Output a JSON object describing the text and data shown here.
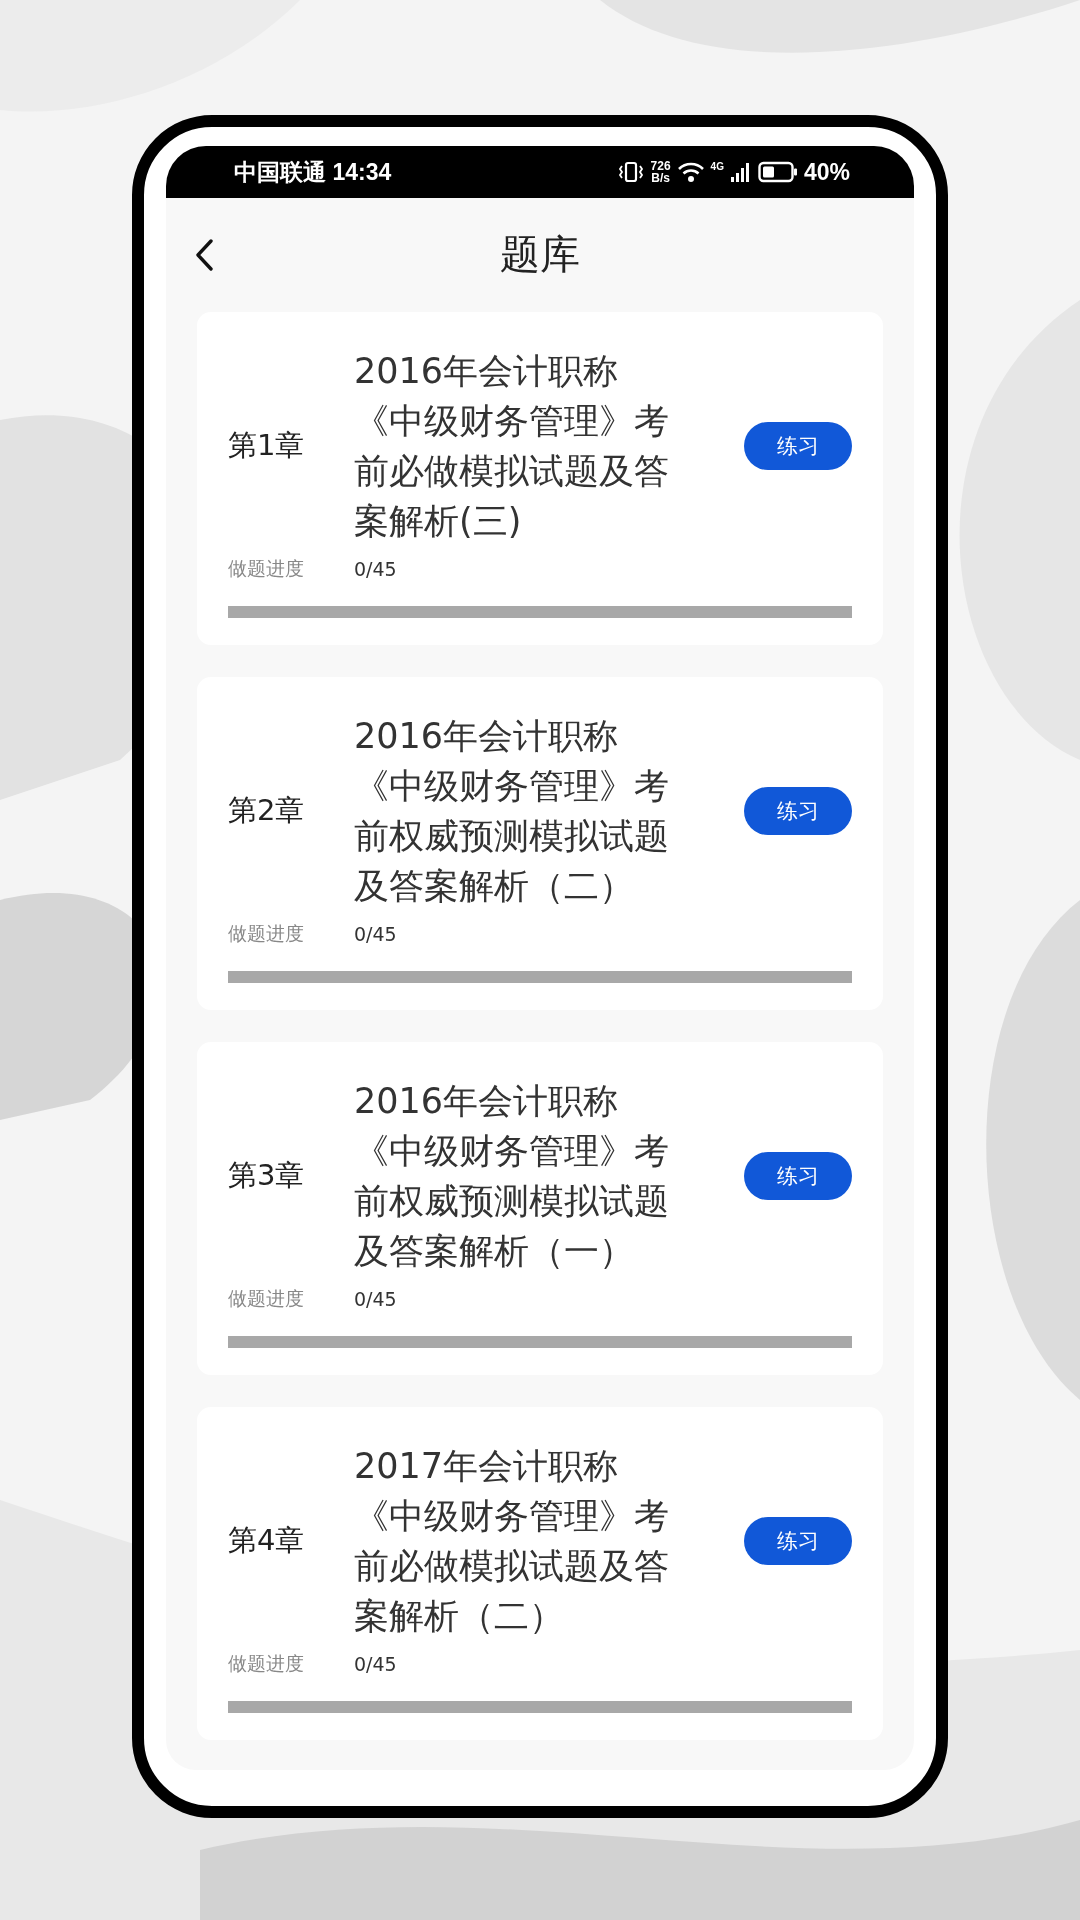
{
  "status_bar": {
    "carrier_time": "中国联通 14:34",
    "net_speed_value": "726",
    "net_speed_unit": "B/s",
    "network_type": "4G",
    "battery_level_text": "40%"
  },
  "header": {
    "title": "题库"
  },
  "chapters": [
    {
      "chapter": "第1章",
      "title": "2016年会计职称《中级财务管理》考前必做模拟试题及答案解析(三)",
      "button": "练习",
      "progress_label": "做题进度",
      "progress_text": "0/45",
      "level": 0
    },
    {
      "chapter": "第2章",
      "title": "2016年会计职称《中级财务管理》考前权威预测模拟试题及答案解析（二）",
      "button": "练习",
      "progress_label": "做题进度",
      "progress_text": "0/45",
      "level": 0
    },
    {
      "chapter": "第3章",
      "title": "2016年会计职称《中级财务管理》考前权威预测模拟试题及答案解析（一）",
      "button": "练习",
      "progress_label": "做题进度",
      "progress_text": "0/45",
      "level": 0
    },
    {
      "chapter": "第4章",
      "title": "2017年会计职称《中级财务管理》考前必做模拟试题及答案解析（二）",
      "button": "练习",
      "progress_label": "做题进度",
      "progress_text": "0/45",
      "level": 0
    }
  ]
}
